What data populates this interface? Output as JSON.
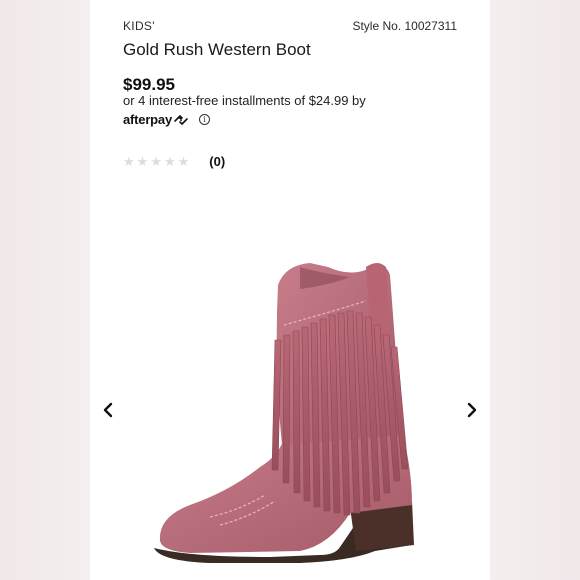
{
  "product": {
    "category": "KIDS'",
    "style_number": "Style No. 10027311",
    "title": "Gold Rush Western Boot",
    "price": "$99.95",
    "installments_text": "or 4 interest-free installments of $24.99 by",
    "payment_provider": "afterpay",
    "rating": {
      "stars_filled": 0,
      "stars_total": 5,
      "review_count": "(0)"
    }
  },
  "icons": {
    "afterpay_mark": "afterpay-arrows-icon",
    "info": "info-icon",
    "prev": "chevron-left-icon",
    "next": "chevron-right-icon",
    "star": "star-icon"
  },
  "colors": {
    "boot": "#b46a78",
    "star_empty": "#dcdcdc",
    "background": "#f4eeee"
  }
}
